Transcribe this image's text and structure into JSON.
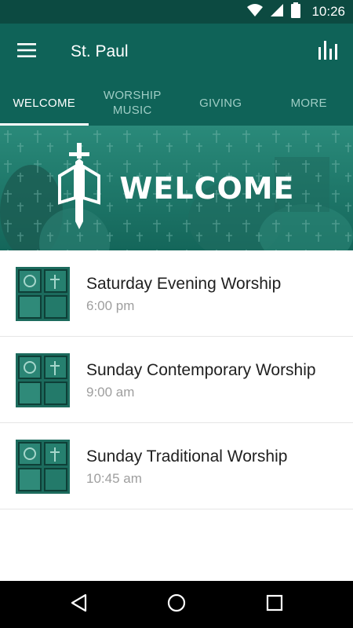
{
  "status_bar": {
    "time": "10:26",
    "icons": [
      "wifi-icon",
      "signal-icon",
      "battery-icon"
    ]
  },
  "app_bar": {
    "title": "St. Paul",
    "menu_icon": "hamburger-menu-icon",
    "action_icon": "bar-chart-icon"
  },
  "tabs": [
    {
      "label": "WELCOME",
      "active": true
    },
    {
      "label": "WORSHIP\nMUSIC",
      "active": false
    },
    {
      "label": "GIVING",
      "active": false
    },
    {
      "label": "MORE",
      "active": false
    }
  ],
  "banner": {
    "title": "WELCOME",
    "icon": "sword-book-logo-icon"
  },
  "services": [
    {
      "title": "Saturday Evening Worship",
      "time": "6:00 pm"
    },
    {
      "title": "Sunday Contemporary Worship",
      "time": "9:00 am"
    },
    {
      "title": "Sunday Traditional Worship",
      "time": "10:45 am"
    }
  ],
  "nav_bar": {
    "icons": [
      "back-icon",
      "home-icon",
      "recents-icon"
    ]
  },
  "colors": {
    "status_bar": "#0c4a41",
    "app_bar": "#0f6358",
    "tab_inactive": "#9fcdc5",
    "banner": "#1a7a6b"
  }
}
